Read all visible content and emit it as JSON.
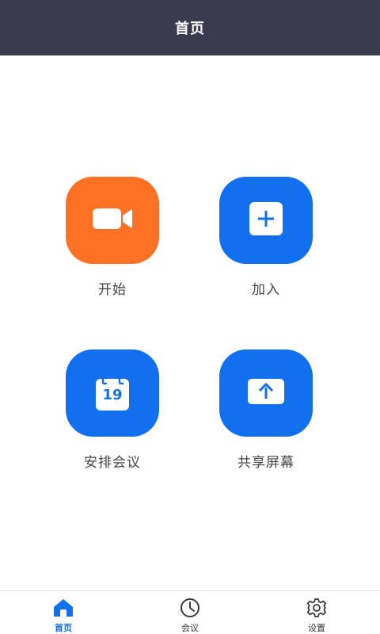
{
  "header": {
    "title": "首页"
  },
  "actions": [
    {
      "id": "start",
      "label": "开始",
      "icon": "video-camera-icon",
      "color": "#ff7226"
    },
    {
      "id": "join",
      "label": "加入",
      "icon": "plus-icon",
      "color": "#1270ee"
    },
    {
      "id": "schedule",
      "label": "安排会议",
      "icon": "calendar-icon",
      "color": "#1270ee",
      "calendar_day": "19"
    },
    {
      "id": "share",
      "label": "共享屏幕",
      "icon": "share-screen-icon",
      "color": "#1270ee"
    }
  ],
  "tabs": [
    {
      "id": "home",
      "label": "首页",
      "icon": "home-icon",
      "active": true,
      "color": "#1270ee"
    },
    {
      "id": "meetings",
      "label": "会议",
      "icon": "clock-icon",
      "active": false,
      "color": "#3a3a3a"
    },
    {
      "id": "settings",
      "label": "设置",
      "icon": "gear-icon",
      "active": false,
      "color": "#3a3a3a"
    }
  ]
}
